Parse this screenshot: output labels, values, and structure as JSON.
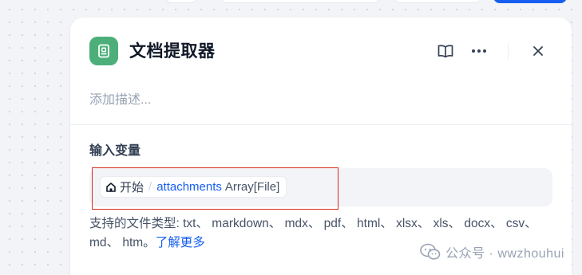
{
  "node": {
    "title": "文档提取器",
    "description_placeholder": "添加描述...",
    "icon": "document-extractor-icon",
    "accent_color": "#4caf7a"
  },
  "toolbar": {
    "help_icon": "book-open-icon",
    "more_icon": "more-horizontal-icon",
    "close_icon": "close-icon"
  },
  "input_section": {
    "title": "输入变量",
    "variable": {
      "source_node": "开始",
      "separator": "/",
      "name": "attachments",
      "type": "Array[File]"
    }
  },
  "supported_types": {
    "text": "支持的文件类型: txt、 markdown、 mdx、 pdf、 html、 xlsx、 xls、 docx、 csv、 md、 htm。",
    "learn_more": "了解更多"
  },
  "watermark": {
    "text": "公众号 · wwzhouhui"
  }
}
